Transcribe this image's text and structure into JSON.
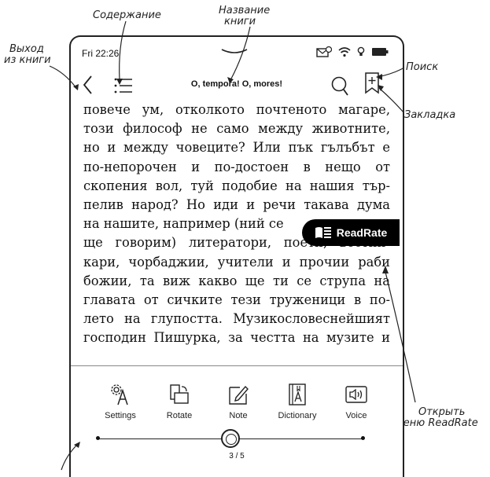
{
  "callouts": {
    "contents": "Содержание",
    "title_line1": "Название",
    "title_line2": "книги",
    "exit_line1": "Выход",
    "exit_line2": "из книги",
    "search": "Поиск",
    "bookmark": "Закладка",
    "readrate_line1": "Открыть",
    "readrate_line2": "меню ReadRate"
  },
  "status": {
    "time": "Fri 22:26"
  },
  "toolbar": {
    "title": "O, tempora! O, mores!"
  },
  "reading": {
    "lines": [
      "повече ум, отколкото почтеното магаре,",
      "този философ не само между животните,",
      "но и между човеците? Или пък гълъбът е",
      "по-непорочен и по-достоен в нещо от",
      "скопения вол, туй подобие на нашия тър-",
      "пелив народ? Но иди и речи такава дума",
      "на нашите, например (ний се",
      "ще говорим) литератори, поети, вестни-",
      "кари, чорбаджии, учители и прочии раби",
      "божии, та виж какво ще ти се струпа на",
      "главата от сичките тези труженици в по-",
      "лето на глупостта. Музикословеснейшият",
      "господин Пишурка, за честта на музите и"
    ]
  },
  "readrate": {
    "label": "ReadRate"
  },
  "quick_menu": [
    {
      "label": "Settings",
      "icon": "settings-icon"
    },
    {
      "label": "Rotate",
      "icon": "rotate-icon"
    },
    {
      "label": "Note",
      "icon": "note-icon"
    },
    {
      "label": "Dictionary",
      "icon": "dictionary-icon"
    },
    {
      "label": "Voice",
      "icon": "voice-icon"
    }
  ],
  "progress": {
    "page_text": "3 / 5",
    "current": 3,
    "total": 5
  }
}
